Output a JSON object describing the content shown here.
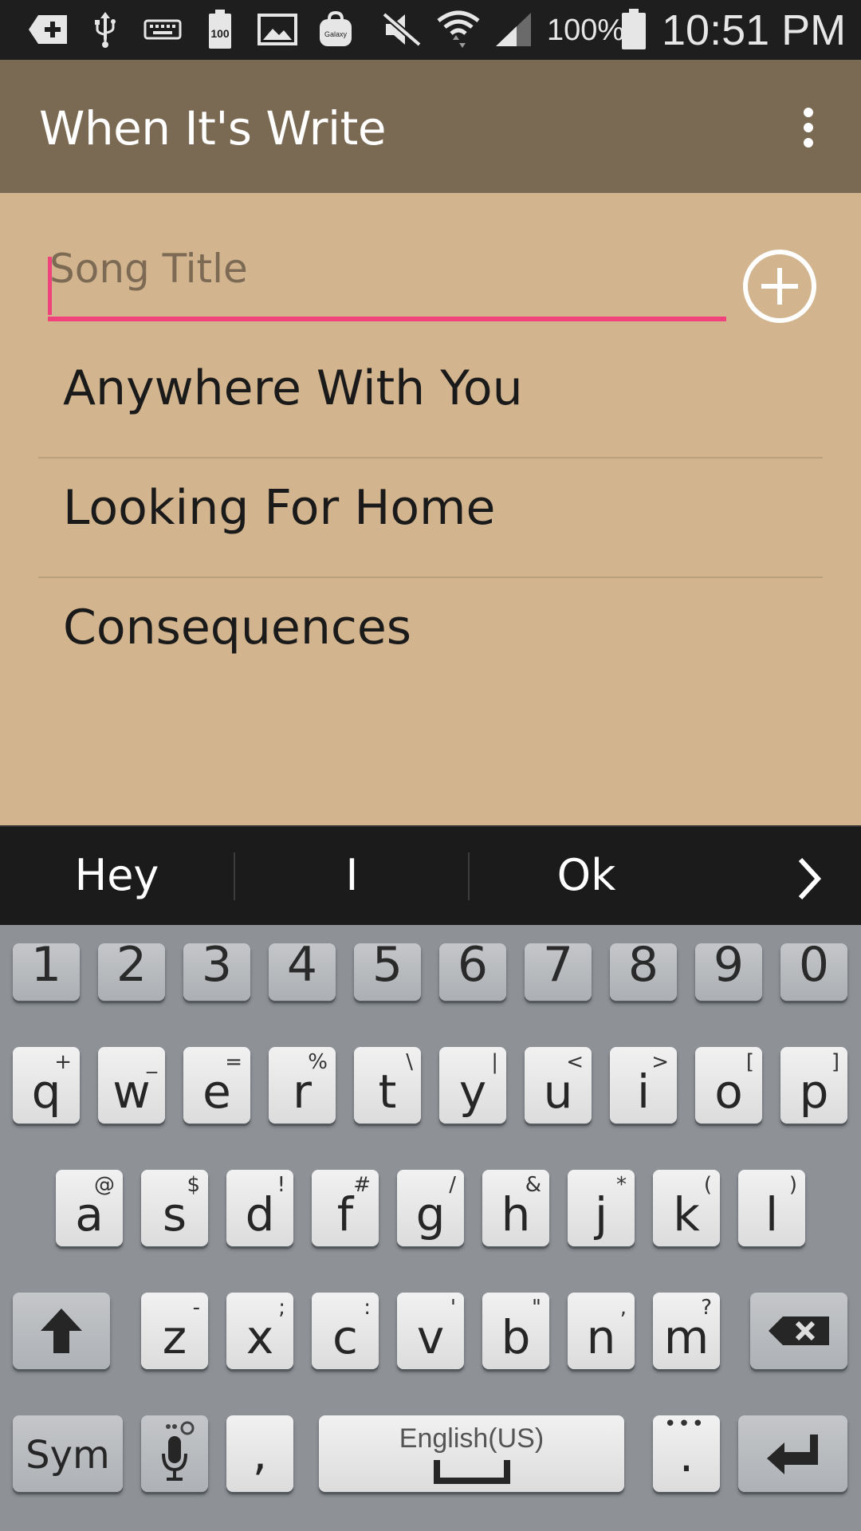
{
  "status_bar": {
    "battery_icon_label": "100",
    "galaxy_icon_label": "Galaxy",
    "battery_percent": "100%",
    "time": "10:51 PM",
    "icons": [
      "add-box-icon",
      "usb-icon",
      "keyboard-icon",
      "battery-saver-icon",
      "image-icon",
      "galaxy-store-icon",
      "mute-icon",
      "wifi-icon",
      "signal-icon",
      "battery-icon"
    ]
  },
  "app_bar": {
    "title": "When It's Write",
    "menu_icon": "overflow-menu-icon"
  },
  "song_input": {
    "placeholder": "Song Title",
    "value": "",
    "add_icon": "add-circle-icon"
  },
  "songs": [
    {
      "title": "Anywhere With You"
    },
    {
      "title": "Looking For Home"
    },
    {
      "title": "Consequences"
    }
  ],
  "suggestions": {
    "items": [
      "Hey",
      "I",
      "Ok"
    ],
    "next_icon": "chevron-right-icon"
  },
  "keyboard": {
    "number_row": [
      "1",
      "2",
      "3",
      "4",
      "5",
      "6",
      "7",
      "8",
      "9",
      "0"
    ],
    "row1": [
      {
        "key": "q",
        "hint": "+"
      },
      {
        "key": "w",
        "hint": "_"
      },
      {
        "key": "e",
        "hint": "="
      },
      {
        "key": "r",
        "hint": "%"
      },
      {
        "key": "t",
        "hint": "\\"
      },
      {
        "key": "y",
        "hint": "|"
      },
      {
        "key": "u",
        "hint": "<"
      },
      {
        "key": "i",
        "hint": ">"
      },
      {
        "key": "o",
        "hint": "["
      },
      {
        "key": "p",
        "hint": "]"
      }
    ],
    "row2": [
      {
        "key": "a",
        "hint": "@"
      },
      {
        "key": "s",
        "hint": "$"
      },
      {
        "key": "d",
        "hint": "!"
      },
      {
        "key": "f",
        "hint": "#"
      },
      {
        "key": "g",
        "hint": "/"
      },
      {
        "key": "h",
        "hint": "&"
      },
      {
        "key": "j",
        "hint": "*"
      },
      {
        "key": "k",
        "hint": "("
      },
      {
        "key": "l",
        "hint": ")"
      }
    ],
    "row3": [
      {
        "key": "z",
        "hint": "-"
      },
      {
        "key": "x",
        "hint": ";"
      },
      {
        "key": "c",
        "hint": ":"
      },
      {
        "key": "v",
        "hint": "'"
      },
      {
        "key": "b",
        "hint": "\""
      },
      {
        "key": "n",
        "hint": ","
      },
      {
        "key": "m",
        "hint": "?"
      }
    ],
    "sym_label": "Sym",
    "comma_label": ",",
    "space_label": "English(US)",
    "period_label": ".",
    "period_hint": "•••",
    "shift_icon": "shift-arrow-icon",
    "backspace_icon": "backspace-icon",
    "mic_icon": "microphone-icon",
    "enter_icon": "enter-icon"
  },
  "colors": {
    "app_bar": "#7b6a53",
    "content_background": "#d2b48e",
    "accent": "#f0437b",
    "keyboard_background": "#8e9297"
  }
}
